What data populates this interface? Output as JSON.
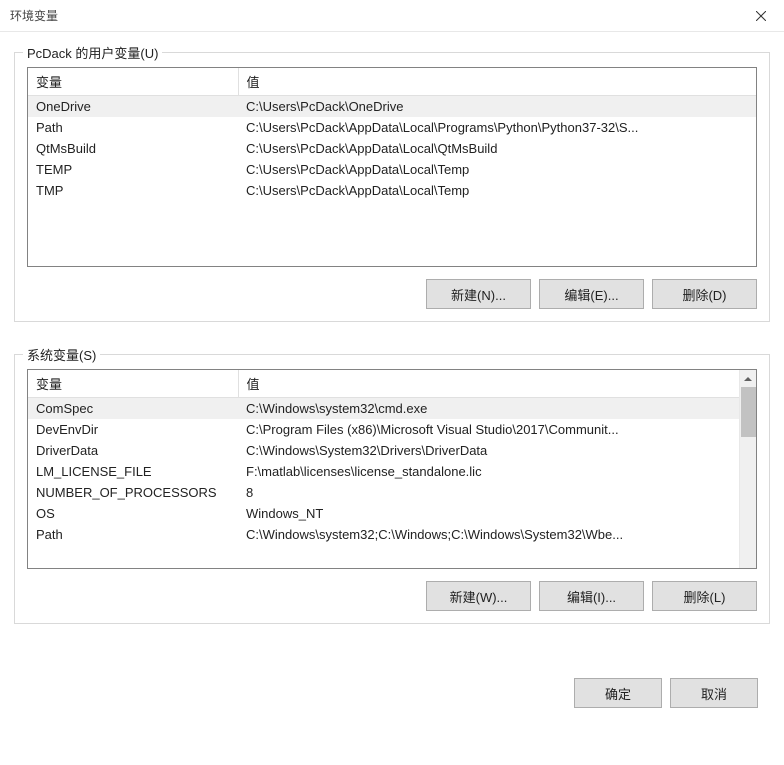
{
  "window": {
    "title": "环境变量"
  },
  "userSection": {
    "label": "PcDack 的用户变量(U)",
    "headers": {
      "variable": "变量",
      "value": "值"
    },
    "rows": [
      {
        "variable": "OneDrive",
        "value": "C:\\Users\\PcDack\\OneDrive"
      },
      {
        "variable": "Path",
        "value": "C:\\Users\\PcDack\\AppData\\Local\\Programs\\Python\\Python37-32\\S..."
      },
      {
        "variable": "QtMsBuild",
        "value": "C:\\Users\\PcDack\\AppData\\Local\\QtMsBuild"
      },
      {
        "variable": "TEMP",
        "value": "C:\\Users\\PcDack\\AppData\\Local\\Temp"
      },
      {
        "variable": "TMP",
        "value": "C:\\Users\\PcDack\\AppData\\Local\\Temp"
      }
    ],
    "buttons": {
      "new": "新建(N)...",
      "edit": "编辑(E)...",
      "del": "删除(D)"
    }
  },
  "systemSection": {
    "label": "系统变量(S)",
    "headers": {
      "variable": "变量",
      "value": "值"
    },
    "rows": [
      {
        "variable": "ComSpec",
        "value": "C:\\Windows\\system32\\cmd.exe"
      },
      {
        "variable": "DevEnvDir",
        "value": "C:\\Program Files (x86)\\Microsoft Visual Studio\\2017\\Communit..."
      },
      {
        "variable": "DriverData",
        "value": "C:\\Windows\\System32\\Drivers\\DriverData"
      },
      {
        "variable": "LM_LICENSE_FILE",
        "value": "F:\\matlab\\licenses\\license_standalone.lic"
      },
      {
        "variable": "NUMBER_OF_PROCESSORS",
        "value": "8"
      },
      {
        "variable": "OS",
        "value": "Windows_NT"
      },
      {
        "variable": "Path",
        "value": "C:\\Windows\\system32;C:\\Windows;C:\\Windows\\System32\\Wbe..."
      }
    ],
    "buttons": {
      "new": "新建(W)...",
      "edit": "编辑(I)...",
      "del": "删除(L)"
    }
  },
  "dialog": {
    "ok": "确定",
    "cancel": "取消"
  }
}
